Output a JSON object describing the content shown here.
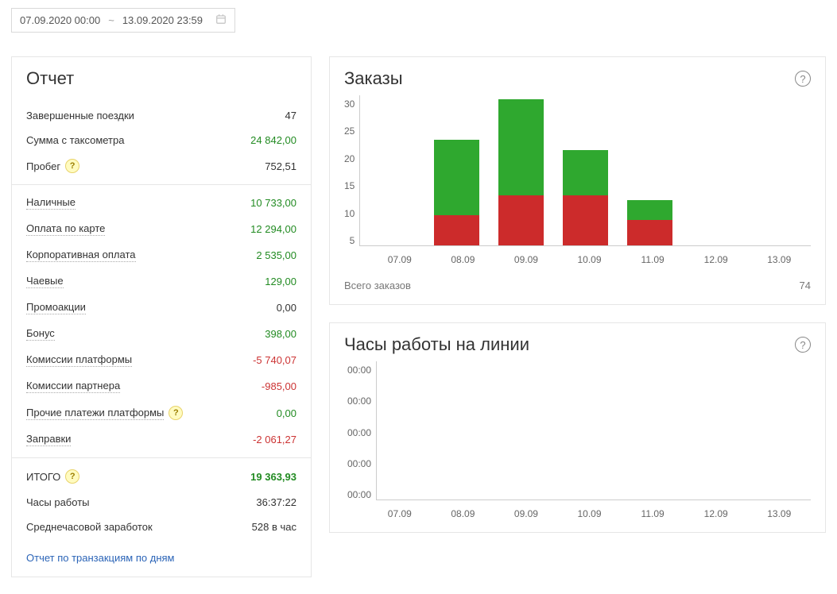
{
  "date_range": {
    "start": "07.09.2020 00:00",
    "end": "13.09.2020 23:59",
    "separator": "~"
  },
  "report": {
    "title": "Отчет",
    "section1": [
      {
        "label": "Завершенные поездки",
        "value": "47",
        "color": ""
      },
      {
        "label": "Сумма с таксометра",
        "value": "24 842,00",
        "color": "green"
      },
      {
        "label": "Пробег",
        "value": "752,51",
        "color": "",
        "help": true
      }
    ],
    "section2": [
      {
        "label": "Наличные",
        "value": "10 733,00",
        "color": "green",
        "dotted": true
      },
      {
        "label": "Оплата по карте",
        "value": "12 294,00",
        "color": "green",
        "dotted": true
      },
      {
        "label": "Корпоративная оплата",
        "value": "2 535,00",
        "color": "green",
        "dotted": true
      },
      {
        "label": "Чаевые",
        "value": "129,00",
        "color": "green",
        "dotted": true
      },
      {
        "label": "Промоакции",
        "value": "0,00",
        "color": "",
        "dotted": true
      },
      {
        "label": "Бонус",
        "value": "398,00",
        "color": "green",
        "dotted": true
      },
      {
        "label": "Комиссии платформы",
        "value": "-5 740,07",
        "color": "red",
        "dotted": true
      },
      {
        "label": "Комиссии партнера",
        "value": "-985,00",
        "color": "red",
        "dotted": true
      },
      {
        "label": "Прочие платежи платформы",
        "value": "0,00",
        "color": "green",
        "dotted": true,
        "help": true
      },
      {
        "label": "Заправки",
        "value": "-2 061,27",
        "color": "red",
        "dotted": true
      }
    ],
    "section3": [
      {
        "label": "ИТОГО",
        "value": "19 363,93",
        "color": "green",
        "bold": true,
        "help": true
      },
      {
        "label": "Часы работы",
        "value": "36:37:22",
        "color": ""
      },
      {
        "label": "Среднечасовой заработок",
        "value": "528 в час",
        "color": ""
      }
    ],
    "link": "Отчет по транзакциям по дням"
  },
  "orders": {
    "title": "Заказы",
    "footer_label": "Всего заказов",
    "footer_value": "74"
  },
  "hours": {
    "title": "Часы работы на линии"
  },
  "chart_data": [
    {
      "type": "bar",
      "title": "Заказы",
      "xlabel": "",
      "ylabel": "",
      "ylim": [
        0,
        30
      ],
      "categories": [
        "07.09",
        "08.09",
        "09.09",
        "10.09",
        "11.09",
        "12.09",
        "13.09"
      ],
      "series": [
        {
          "name": "red",
          "color": "#cc2b2b",
          "values": [
            0,
            6,
            10,
            10,
            5,
            0,
            0
          ]
        },
        {
          "name": "green",
          "color": "#2fa82f",
          "values": [
            0,
            15,
            19,
            9,
            4,
            0,
            0
          ]
        }
      ],
      "yticks": [
        5,
        10,
        15,
        20,
        25,
        30
      ]
    },
    {
      "type": "bar",
      "title": "Часы работы на линии",
      "xlabel": "",
      "ylabel": "",
      "categories": [
        "07.09",
        "08.09",
        "09.09",
        "10.09",
        "11.09",
        "12.09",
        "13.09"
      ],
      "series": [],
      "yticks": [
        "00:00",
        "00:00",
        "00:00",
        "00:00",
        "00:00"
      ]
    }
  ]
}
